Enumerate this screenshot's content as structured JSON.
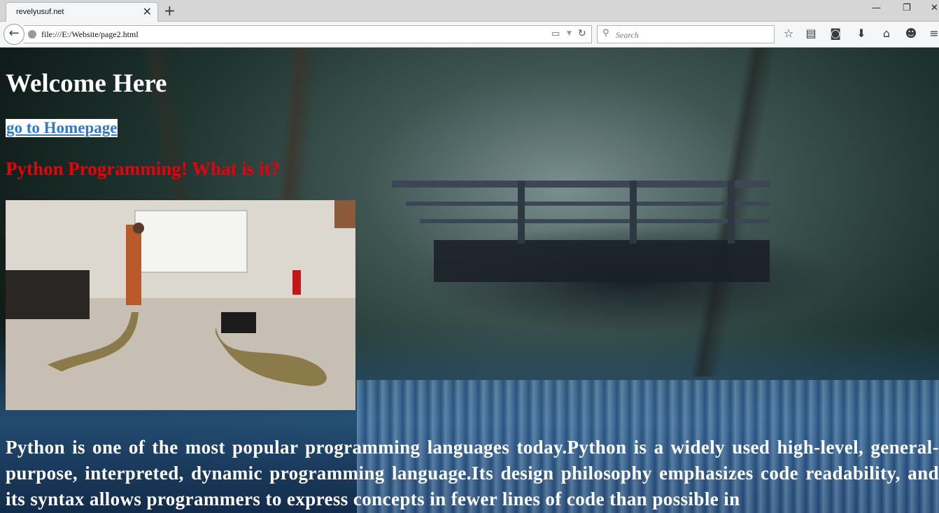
{
  "browser": {
    "tab_title": "revelyusuf.net",
    "tab_close": "✕",
    "new_tab": "+",
    "url": "file:///E:/Website/page2.html",
    "search_placeholder": "Search",
    "window_controls": [
      "—",
      "❐",
      "✕"
    ],
    "toolbar_icons": [
      "star-icon",
      "reading-list-icon",
      "pocket-icon",
      "download-icon",
      "home-icon",
      "hello-icon",
      "menu-icon"
    ]
  },
  "page": {
    "heading": "Welcome Here",
    "home_link": "go to Homepage",
    "subheading": "Python Programming! What is it?",
    "subheading_color": "#e8000b",
    "link_color": "#2f79c7",
    "body_text": "Python is one of the most popular programming languages today.Python is a widely used high-level, general-purpose, interpreted, dynamic programming language.Its design philosophy emphasizes code readability, and its syntax allows programmers to express concepts in fewer lines of code than possible in"
  }
}
